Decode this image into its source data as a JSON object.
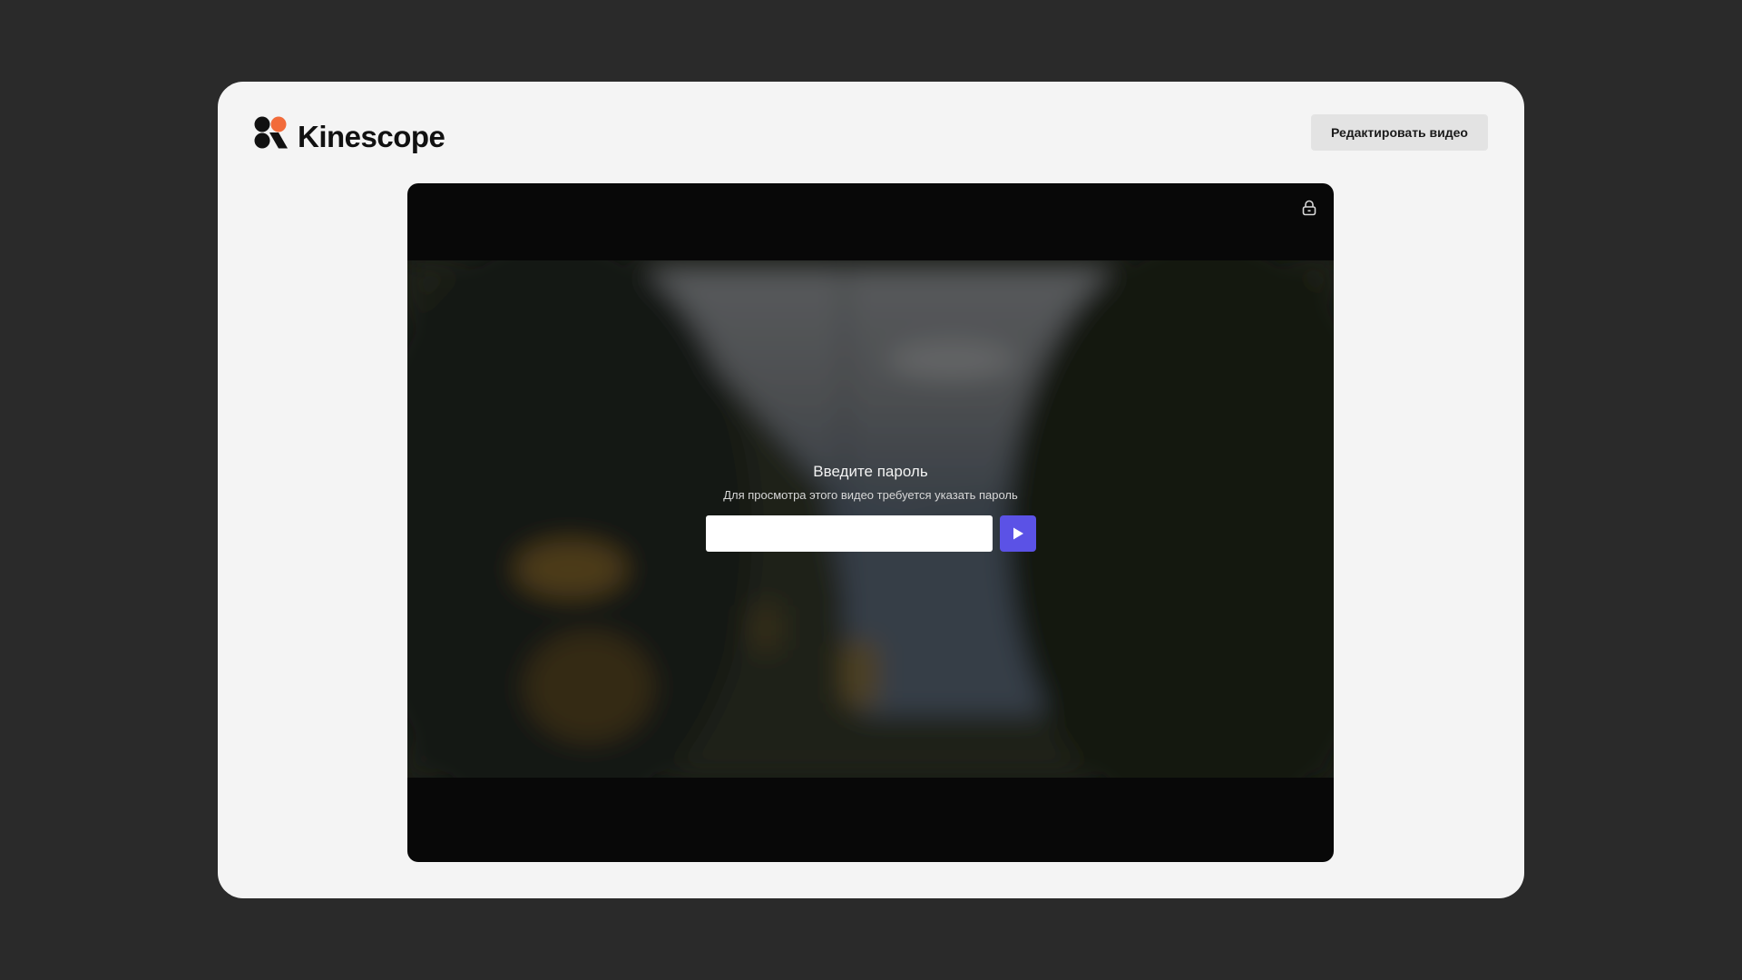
{
  "header": {
    "logo_text": "Kinescope",
    "edit_button_label": "Редактировать видео"
  },
  "player": {
    "lock_icon": "lock-icon",
    "password_prompt": {
      "title": "Введите пароль",
      "subtitle": "Для просмотра этого видео требуется указать пароль",
      "input_value": "",
      "submit_icon": "play-icon"
    }
  },
  "colors": {
    "page_background": "#2a2a2a",
    "card_background": "#f4f4f4",
    "submit_button": "#5b52e6",
    "logo_orange": "#f26b3a",
    "logo_black": "#111111"
  }
}
